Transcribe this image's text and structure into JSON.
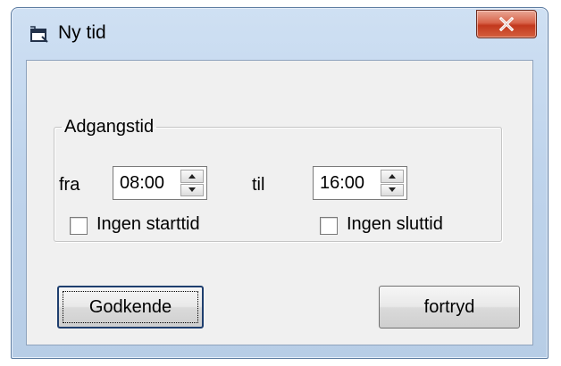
{
  "window": {
    "title": "Ny tid",
    "close_glyph": "X"
  },
  "group": {
    "legend": "Adgangstid",
    "from_label": "fra",
    "to_label": "til",
    "start_time": "08:00",
    "end_time": "16:00",
    "no_start_label": "Ingen starttid",
    "no_end_label": "Ingen sluttid",
    "no_start_checked": false,
    "no_end_checked": false
  },
  "buttons": {
    "ok_label": "Godkende",
    "cancel_label": "fortryd"
  },
  "icons": {
    "title": "window-app-icon",
    "close": "close-icon",
    "spin_up": "spin-up-icon",
    "spin_down": "spin-down-icon"
  },
  "colors": {
    "frame": "#bfd4ec",
    "close_button": "#c9452a",
    "client_bg": "#f0f0f0",
    "default_button_border": "#1e3e6e"
  }
}
